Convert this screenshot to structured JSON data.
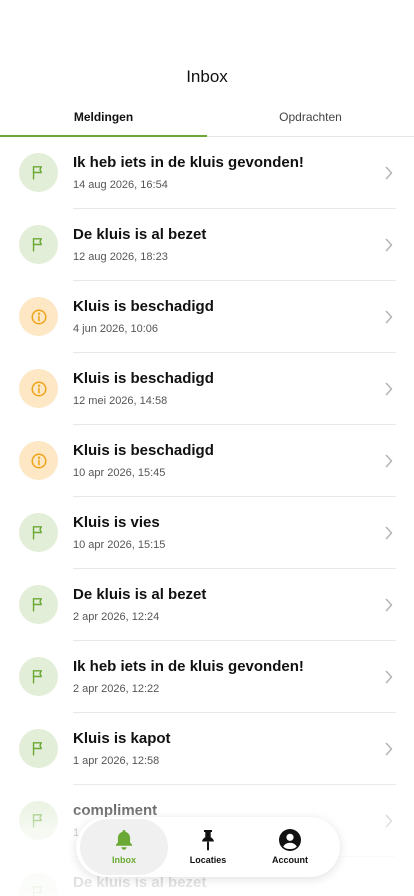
{
  "header": {
    "title": "Inbox"
  },
  "tabs": [
    {
      "label": "Meldingen",
      "active": true
    },
    {
      "label": "Opdrachten",
      "active": false
    }
  ],
  "colors": {
    "accent": "#6aa933",
    "flag_bg": "#e2eed7",
    "info_bg": "#fde7c4",
    "info_fg": "#f0a41c"
  },
  "notifications": [
    {
      "title": "Ik heb iets in de kluis gevonden!",
      "date": "14 aug 2026, 16:54",
      "icon": "flag-icon"
    },
    {
      "title": "De kluis is al bezet",
      "date": "12 aug 2026, 18:23",
      "icon": "flag-icon"
    },
    {
      "title": "Kluis is beschadigd",
      "date": "4 jun 2026, 10:06",
      "icon": "info-icon"
    },
    {
      "title": "Kluis is beschadigd",
      "date": "12 mei 2026, 14:58",
      "icon": "info-icon"
    },
    {
      "title": "Kluis is beschadigd",
      "date": "10 apr 2026, 15:45",
      "icon": "info-icon"
    },
    {
      "title": "Kluis is vies",
      "date": "10 apr 2026, 15:15",
      "icon": "flag-icon"
    },
    {
      "title": "De kluis is al bezet",
      "date": "2 apr 2026, 12:24",
      "icon": "flag-icon"
    },
    {
      "title": "Ik heb iets in de kluis gevonden!",
      "date": "2 apr 2026, 12:22",
      "icon": "flag-icon"
    },
    {
      "title": "Kluis is kapot",
      "date": "1 apr 2026, 12:58",
      "icon": "flag-icon"
    },
    {
      "title": "compliment",
      "date": "1",
      "icon": "flag-icon"
    },
    {
      "title": "De kluis is al bezet",
      "date": "",
      "icon": "flag-icon"
    }
  ],
  "nav": {
    "items": [
      {
        "label": "Inbox",
        "icon": "bell-icon",
        "active": true
      },
      {
        "label": "Locaties",
        "icon": "pin-icon",
        "active": false
      },
      {
        "label": "Account",
        "icon": "account-icon",
        "active": false
      }
    ]
  }
}
